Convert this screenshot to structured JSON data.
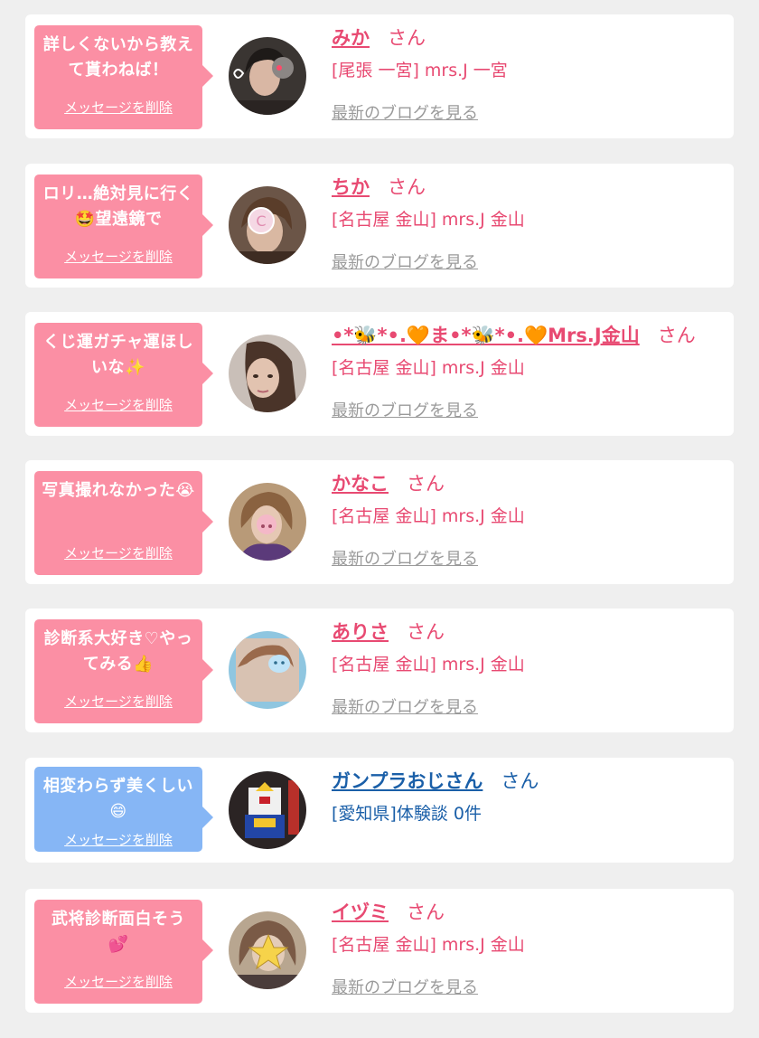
{
  "colors": {
    "pink_bubble": "#fb8fa4",
    "blue_bubble": "#86b6f5",
    "pink_text": "#e84a72",
    "blue_text": "#1a5fa8",
    "blog_link": "#9a9a9a"
  },
  "items": [
    {
      "message": "詳しくないから教えて貰わねば！",
      "delete_label": "メッセージを削除",
      "name": "みか",
      "honorific": "さん",
      "shop": "[尾張 一宮] mrs.J 一宮",
      "blog_label": "最新のブログを見る",
      "theme": "pink"
    },
    {
      "message": "ロリ…絶対見に行く🤩望遠鏡で",
      "delete_label": "メッセージを削除",
      "name": "ちか",
      "honorific": "さん",
      "shop": "[名古屋 金山] mrs.J 金山",
      "blog_label": "最新のブログを見る",
      "theme": "pink"
    },
    {
      "message": "くじ運ガチャ運ほしいな✨",
      "delete_label": "メッセージを削除",
      "name": "•*🐝*•.🧡ま•*🐝*•.🧡Mrs.J金山",
      "honorific": "さん",
      "shop": "[名古屋 金山] mrs.J 金山",
      "blog_label": "最新のブログを見る",
      "theme": "pink"
    },
    {
      "message": "写真撮れなかった😭",
      "delete_label": "メッセージを削除",
      "name": "かなこ",
      "honorific": "さん",
      "shop": "[名古屋 金山] mrs.J 金山",
      "blog_label": "最新のブログを見る",
      "theme": "pink"
    },
    {
      "message": "診断系大好き♡やってみる👍",
      "delete_label": "メッセージを削除",
      "name": "ありさ",
      "honorific": "さん",
      "shop": "[名古屋 金山] mrs.J 金山",
      "blog_label": "最新のブログを見る",
      "theme": "pink"
    },
    {
      "message": "相変わらず美くしい😄",
      "delete_label": "メッセージを削除",
      "name": "ガンプラおじさん",
      "honorific": "さん",
      "shop": "[愛知県]体験談 0件",
      "blog_label": "",
      "theme": "blue"
    },
    {
      "message": "武将診断面白そう💕",
      "delete_label": "メッセージを削除",
      "name": "イヅミ",
      "honorific": "さん",
      "shop": "[名古屋 金山] mrs.J 金山",
      "blog_label": "最新のブログを見る",
      "theme": "pink"
    }
  ]
}
